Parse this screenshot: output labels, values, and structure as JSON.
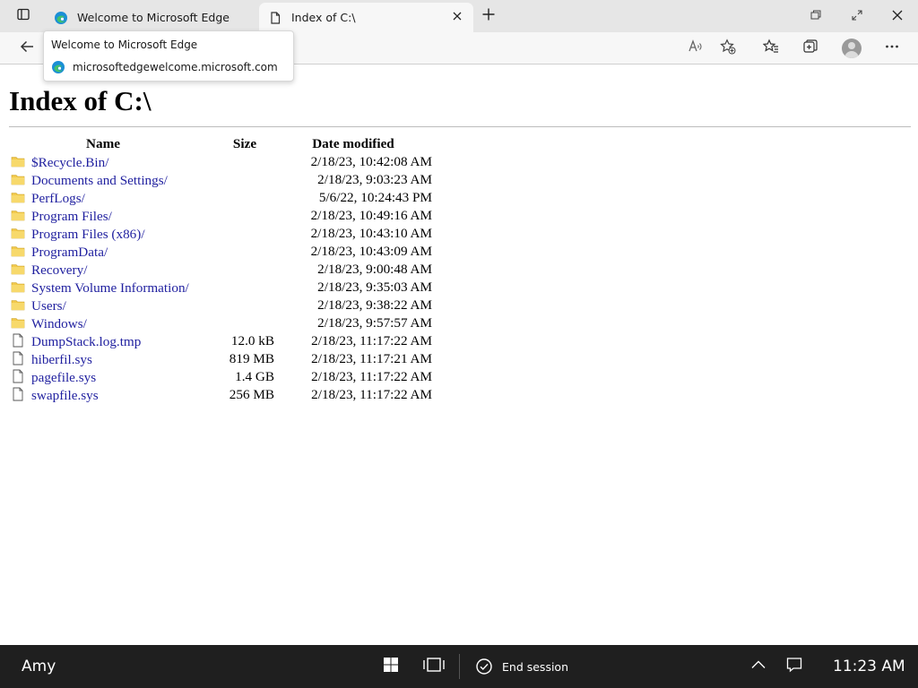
{
  "browser": {
    "tabs": [
      {
        "title": "Welcome to Microsoft Edge",
        "icon": "edge-logo-icon"
      },
      {
        "title": "Index of C:\\",
        "icon": "page-icon"
      }
    ],
    "hover_card": {
      "title": "Welcome to Microsoft Edge",
      "url": "microsoftedgewelcome.microsoft.com"
    },
    "toolbar_icons": [
      "back-icon",
      "read-aloud-icon",
      "add-favorite-icon",
      "favorites-icon",
      "collections-icon",
      "profile-icon",
      "more-icon"
    ]
  },
  "page": {
    "title": "Index of C:\\",
    "columns": {
      "name": "Name",
      "size": "Size",
      "date": "Date modified"
    },
    "entries": [
      {
        "type": "folder",
        "name": "$Recycle.Bin/",
        "size": "",
        "date": "2/18/23, 10:42:08 AM"
      },
      {
        "type": "folder",
        "name": "Documents and Settings/",
        "size": "",
        "date": "2/18/23, 9:03:23 AM"
      },
      {
        "type": "folder",
        "name": "PerfLogs/",
        "size": "",
        "date": "5/6/22, 10:24:43 PM"
      },
      {
        "type": "folder",
        "name": "Program Files/",
        "size": "",
        "date": "2/18/23, 10:49:16 AM"
      },
      {
        "type": "folder",
        "name": "Program Files (x86)/",
        "size": "",
        "date": "2/18/23, 10:43:10 AM"
      },
      {
        "type": "folder",
        "name": "ProgramData/",
        "size": "",
        "date": "2/18/23, 10:43:09 AM"
      },
      {
        "type": "folder",
        "name": "Recovery/",
        "size": "",
        "date": "2/18/23, 9:00:48 AM"
      },
      {
        "type": "folder",
        "name": "System Volume Information/",
        "size": "",
        "date": "2/18/23, 9:35:03 AM"
      },
      {
        "type": "folder",
        "name": "Users/",
        "size": "",
        "date": "2/18/23, 9:38:22 AM"
      },
      {
        "type": "folder",
        "name": "Windows/",
        "size": "",
        "date": "2/18/23, 9:57:57 AM"
      },
      {
        "type": "file",
        "name": "DumpStack.log.tmp",
        "size": "12.0 kB",
        "date": "2/18/23, 11:17:22 AM"
      },
      {
        "type": "file",
        "name": "hiberfil.sys",
        "size": "819 MB",
        "date": "2/18/23, 11:17:21 AM"
      },
      {
        "type": "file",
        "name": "pagefile.sys",
        "size": "1.4 GB",
        "date": "2/18/23, 11:17:22 AM"
      },
      {
        "type": "file",
        "name": "swapfile.sys",
        "size": "256 MB",
        "date": "2/18/23, 11:17:22 AM"
      }
    ],
    "link_color": "#1f1f9f",
    "folder_color": "#f2c94c"
  },
  "taskbar": {
    "user": "Amy",
    "end_session_label": "End session",
    "clock": "11:23 AM",
    "icons": [
      "windows-start-icon",
      "task-view-icon",
      "checkmark-circle-icon",
      "chevron-up-icon",
      "notification-icon"
    ]
  }
}
